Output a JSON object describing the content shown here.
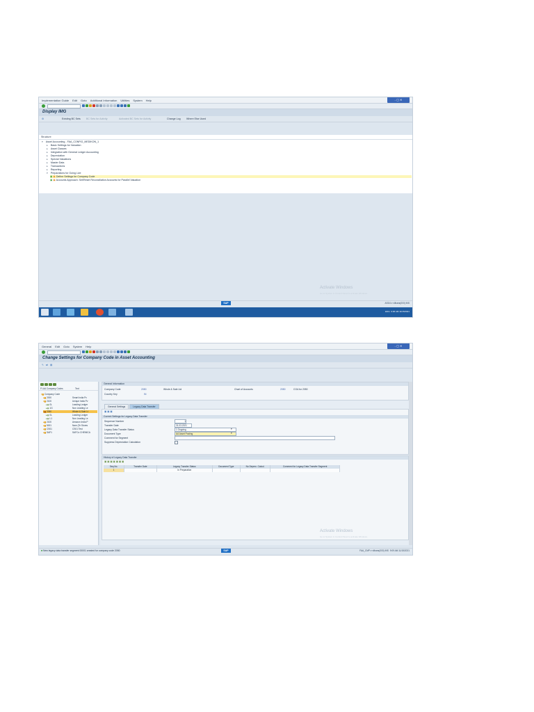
{
  "screenshot1": {
    "window_controls": "- ▢ ✕",
    "menu": [
      "Implementation Guide",
      "Edit",
      "Goto",
      "Additional Information",
      "Utilities",
      "System",
      "Help"
    ],
    "title": "Display IMG",
    "app_toolbar": {
      "existing_bc_sets": "Existing BC Sets",
      "bc_sets_activity": "BC Sets for Activity",
      "activated_bc_sets": "Activated BC Sets for Activity",
      "change_log": "Change Log",
      "where_else_used": "Where Else Used"
    },
    "structure_header": "Structure",
    "tree": {
      "root": "Asset Accounting - FAA_CONFIG_MEDIKON_1",
      "items": [
        "Basic Settings for Valuation",
        "Asset Classes",
        "Integration with General Ledger Accounting",
        "Depreciation",
        "Special Valuations",
        "Master Data",
        "Transactions",
        "Reporting",
        "Preparations for Going Live"
      ],
      "subitems": [
        "Define Settings for Company Code",
        "Accounts Approach: Set/Reset Reconciliation Accounts for Parallel Valuation"
      ]
    },
    "watermark": {
      "title": "Activate Windows",
      "subtitle": "Go to System in Control Panel to activate Windows."
    },
    "sap_logo": "SAP",
    "status_right": "ASG4 ▾  vilhans(000)  INS",
    "tray_time": "9:06 AM",
    "tray_date": "11/15/2021",
    "tray_lang": "ENG"
  },
  "screenshot2": {
    "window_controls": "- ▢ ✕",
    "menu": [
      "General",
      "Edit",
      "Goto",
      "System",
      "Help"
    ],
    "title": "Change Settings for Company Code in Asset Accounting",
    "nav": {
      "headers": [
        "FI-AA Company Codes",
        "Text"
      ],
      "root": "Company Code",
      "rows": [
        {
          "code": "2000",
          "text": "Smart India Pv"
        },
        {
          "code": "2100",
          "text": "Unique India Pv"
        },
        {
          "code": "0L",
          "text": "Leading Ledger"
        },
        {
          "code": "1G",
          "text": "Non Leading Le"
        },
        {
          "code": "2050",
          "text": "Whole & Sale Lt"
        },
        {
          "code": "0L",
          "text": "Leading Ledger"
        },
        {
          "code": "L1",
          "text": "Non Leading Le"
        },
        {
          "code": "2100",
          "text": "Amazon India P"
        },
        {
          "code": "5001",
          "text": "Nam (Te Stores"
        },
        {
          "code": "CS01",
          "text": "CS01 Test"
        },
        {
          "code": "SAF1",
          "text": "SAFCo CHEMICA"
        }
      ]
    },
    "general_info": {
      "header": "General Information",
      "company_code_label": "Company Code",
      "company_code": "2050",
      "company_name": "Whole & Sale Ltd",
      "chart_label": "Chart of Accounts",
      "chart": "2050",
      "chart_name": "COA for 2050",
      "country_label": "Country Key",
      "country": "IN"
    },
    "tabs": [
      "General Settings",
      "Legacy Data Transfer"
    ],
    "legacy": {
      "header": "Current Settings for Legacy Data Transfer",
      "fields": [
        {
          "label": "Sequence Number",
          "value": "1"
        },
        {
          "label": "Transfer Date",
          "value": "31.03.2021"
        },
        {
          "label": "Legacy Data Transfer Status",
          "value": "1 Ongoing"
        },
        {
          "label": "Document Type",
          "value": "AA Asset Posting"
        },
        {
          "label": "Comment for Segment",
          "value": ""
        },
        {
          "label": "Suppress Depreciation Calculation",
          "value": ""
        }
      ]
    },
    "history": {
      "header": "History of Legacy Data Transfer",
      "columns": [
        "Seq.No.",
        "Transfer Date",
        "Legacy Transfer Status",
        "Document Type",
        "No Deprec. Calcul.",
        "Comment for Legacy Data Transfer Segment"
      ],
      "rows": [
        [
          "1",
          "",
          "In Preparation",
          "",
          "",
          ""
        ]
      ]
    },
    "status_message": "New legacy data transfer segment 00001 created for company code 2050",
    "watermark": {
      "title": "Activate Windows",
      "subtitle": "Go to System in Control Panel to activate Windows."
    },
    "sap_logo": "SAP",
    "status_right": "FAA_CMP ▾  vilhans(000)  INS",
    "tray_time": "9:09 AM",
    "tray_date": "11/15/2021"
  },
  "colors": {
    "sap_blue": "#1f6fc5",
    "highlight": "#fdf6b8",
    "selected": "#f6c24a",
    "taskbar": "#1e5ba0"
  }
}
